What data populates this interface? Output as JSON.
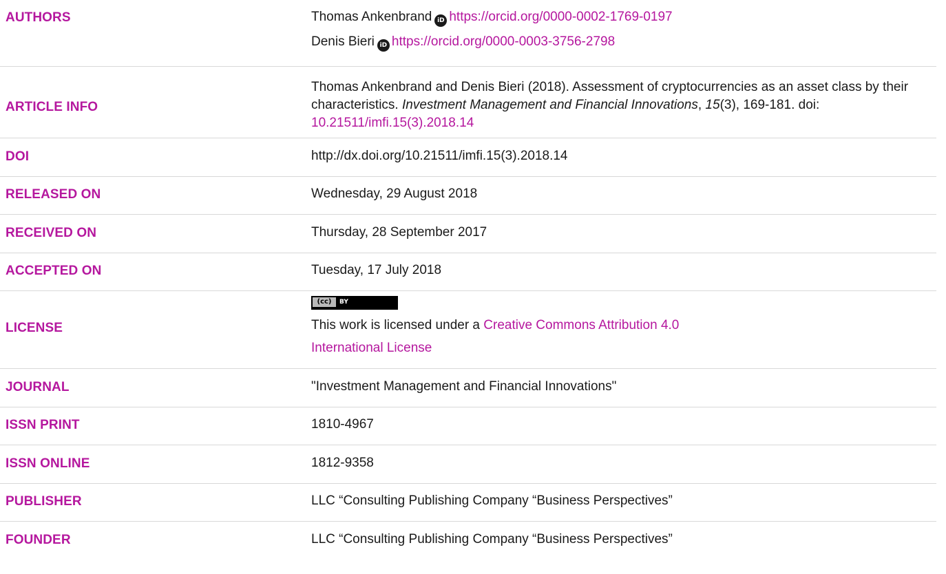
{
  "rows": {
    "authors": {
      "label": "AUTHORS",
      "author1": {
        "name": "Thomas Ankenbrand",
        "orcid": "https://orcid.org/0000-0002-1769-0197"
      },
      "author2": {
        "name": "Denis Bieri",
        "orcid": "https://orcid.org/0000-0003-3756-2798"
      }
    },
    "article_info": {
      "label": "ARTICLE INFO",
      "citation_prefix": "Thomas Ankenbrand and Denis Bieri (2018). Assessment of cryptocurrencies as an asset class by their characteristics. ",
      "journal_italic": "Investment Management and Financial Innovations",
      "comma": ", ",
      "volume_italic": "15",
      "issue_pages": "(3), 169-181. doi: ",
      "doi_link": "10.21511/imfi.15(3).2018.14"
    },
    "doi": {
      "label": "DOI",
      "value": "http://dx.doi.org/10.21511/imfi.15(3).2018.14"
    },
    "released": {
      "label": "RELEASED ON",
      "value": "Wednesday, 29 August 2018"
    },
    "received": {
      "label": "RECEIVED ON",
      "value": "Thursday, 28 September 2017"
    },
    "accepted": {
      "label": "ACCEPTED ON",
      "value": "Tuesday, 17 July 2018"
    },
    "license": {
      "label": "LICENSE",
      "badge_left": "(cc)",
      "badge_right": "BY",
      "text_prefix": "This work is licensed under a ",
      "link": "Creative Commons Attribution 4.0 International License"
    },
    "journal": {
      "label": "JOURNAL",
      "value": "\"Investment Management and Financial Innovations\""
    },
    "issn_print": {
      "label": "ISSN PRINT",
      "value": "1810-4967"
    },
    "issn_online": {
      "label": "ISSN ONLINE",
      "value": "1812-9358"
    },
    "publisher": {
      "label": "PUBLISHER",
      "value": "LLC “Consulting Publishing Company “Business Perspectives”"
    },
    "founder": {
      "label": "FOUNDER",
      "value": "LLC “Consulting Publishing Company “Business Perspectives”"
    }
  },
  "colors": {
    "label": "#b5179e",
    "link": "#b5179e",
    "text": "#1a1a1a",
    "separator": "#d8d8d8"
  },
  "icons": {
    "orcid": "orcid-icon",
    "license": "creative-commons-by-badge"
  }
}
